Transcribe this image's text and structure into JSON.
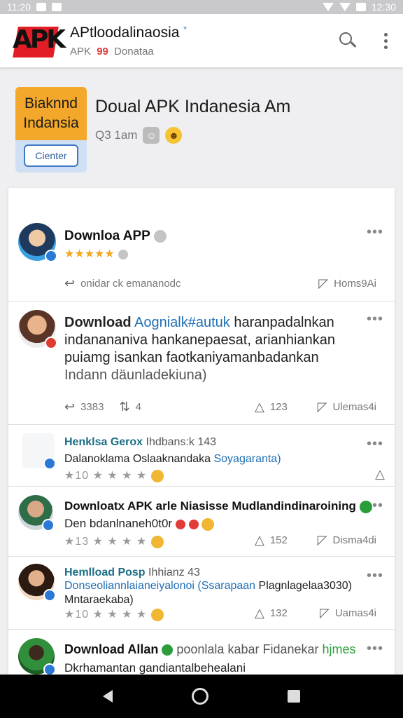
{
  "status_bar": {
    "time_left": "11:20",
    "time_right": "12:30"
  },
  "app_bar": {
    "logo_text": "APK",
    "title": "APtloodalinaosia",
    "title_mark": "*",
    "subtitle_prefix": "APK",
    "subtitle_count": "99",
    "subtitle_suffix": "Donataa"
  },
  "page_header": {
    "cover_line1": "Biaknnd",
    "cover_line2": "Indansia",
    "cover_button": "Cienter",
    "title": "Doual APK Indanesia Am",
    "meta": "Q3 1am"
  },
  "posts": [
    {
      "name": "Downloa APP",
      "rating_stars": "★★★★★",
      "rating_value": 4.5,
      "action_left": "onidar ck emananodc",
      "action_right": "Homs9Ai"
    },
    {
      "name": "Download",
      "name_extra": "Aognialk#autuk",
      "body_line1_rest": "haranpadalnkan",
      "body_line2": "indanananiva hankanepaesat, arianhiankan",
      "body_line3": "puiamg isankan faotkaniyamanbadankan",
      "body_line4": "Indann däunladekiuna)",
      "share_count": "3383",
      "repost_count": "4",
      "like_count": "123",
      "comment_label": "Ulemas4i"
    },
    {
      "name": "Henklsa Gerox",
      "name_suffix": "Ihdbans:k 143",
      "line": "Dalanoklama Oslaaknandaka",
      "line_blue": "Soyagaranta)",
      "stars_text": "★10 ★ ★ ★ ★"
    },
    {
      "name": "Downloatx APK arle Niasisse Mudlandindinaroining",
      "line": "Den bdanlnaneh0t0r",
      "stars_text": "★13 ★ ★ ★ ★",
      "like_count": "152",
      "comment_label": "Disma4di"
    },
    {
      "name": "Hemlload Posp",
      "name_suffix": "Ihhianz 43",
      "line_blue": "Donseoliannlaianeiyalonoi (Ssarapaan",
      "line_dark": "Plagnlagelaa3030)",
      "line2": "Mntaraekaba)",
      "stars_text": "★10 ★ ★ ★ ★",
      "like_count": "132",
      "comment_label": "Uamas4i"
    },
    {
      "name": "Download Allan",
      "name_suffix": "poonlala kabar Fidanekar",
      "name_tag": "hjmes",
      "line": "Dkrhamantan gandiantalbehealani"
    }
  ],
  "nav": {
    "back": "back",
    "home": "home",
    "recents": "recents"
  }
}
